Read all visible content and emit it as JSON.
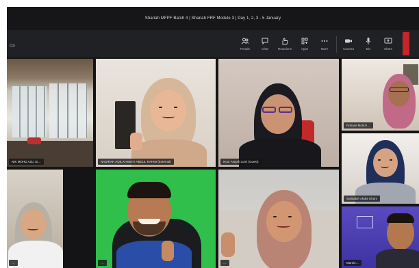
{
  "window": {
    "title": "Shariah MFPF Batch 4 | Shariah FRF Module 3 | Day 1, 2, 3 - 5 January"
  },
  "toolbar": {
    "left_text": "03",
    "items": [
      {
        "icon": "people-icon",
        "label": "People"
      },
      {
        "icon": "chat-icon",
        "label": "Chat"
      },
      {
        "icon": "reactions-icon",
        "label": "Reactions"
      },
      {
        "icon": "apps-icon",
        "label": "Apps"
      },
      {
        "icon": "more-icon",
        "label": "More"
      },
      {
        "icon": "camera-icon",
        "label": "Camera"
      },
      {
        "icon": "mic-icon",
        "label": "Mic"
      },
      {
        "icon": "share-icon",
        "label": "Share"
      }
    ]
  },
  "participants": [
    {
      "name": "NIK MOHD AZLI IZ…"
    },
    {
      "name": "NADIRAH AQILAH BINTI ABDUL RAHIM (External)"
    },
    {
      "name": "Noor Aisyah Lumi (Guest)"
    },
    {
      "name": "Rohaini Mohd I…"
    },
    {
      "name": "Suhaidah Abdul Ghani"
    },
    {
      "name": "Marnie…"
    },
    {
      "name": "…"
    },
    {
      "name": "…"
    },
    {
      "name": "…"
    }
  ],
  "colors": {
    "background": "#1b1b1d",
    "accent_leave": "#c8242c",
    "green_screen": "#2fbf4a"
  }
}
